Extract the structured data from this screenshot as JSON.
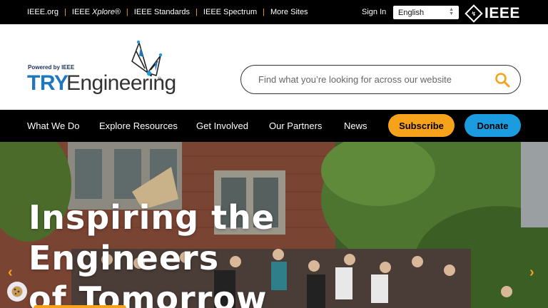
{
  "topbar": {
    "links": [
      {
        "label": "IEEE.org"
      },
      {
        "label": "IEEE ",
        "italic": "Xplore",
        "suffix": "®"
      },
      {
        "label": "IEEE Standards"
      },
      {
        "label": "IEEE Spectrum"
      },
      {
        "label": "More Sites"
      }
    ],
    "sign_in": "Sign In",
    "language": "English",
    "ieee_logo_text": "IEEE"
  },
  "brand": {
    "powered_by": "Powered by IEEE",
    "try": "TRY",
    "engineering": "Engineering",
    "registered": "®"
  },
  "search": {
    "placeholder": "Find what you’re looking for across our website",
    "icon": "search-icon"
  },
  "nav": {
    "items": [
      "What We Do",
      "Explore Resources",
      "Get Involved",
      "Our Partners",
      "News"
    ],
    "subscribe": "Subscribe",
    "donate": "Donate"
  },
  "hero": {
    "headline_line1": "Inspiring the Engineers",
    "headline_line2": "of Tomorrow",
    "prev_icon": "chevron-left-icon",
    "next_icon": "chevron-right-icon",
    "cookie_icon": "cookie-icon"
  },
  "colors": {
    "accent_orange": "#f7a21b",
    "accent_blue": "#1b9be0",
    "brand_blue": "#1f77bf",
    "bar_black": "#000000"
  }
}
